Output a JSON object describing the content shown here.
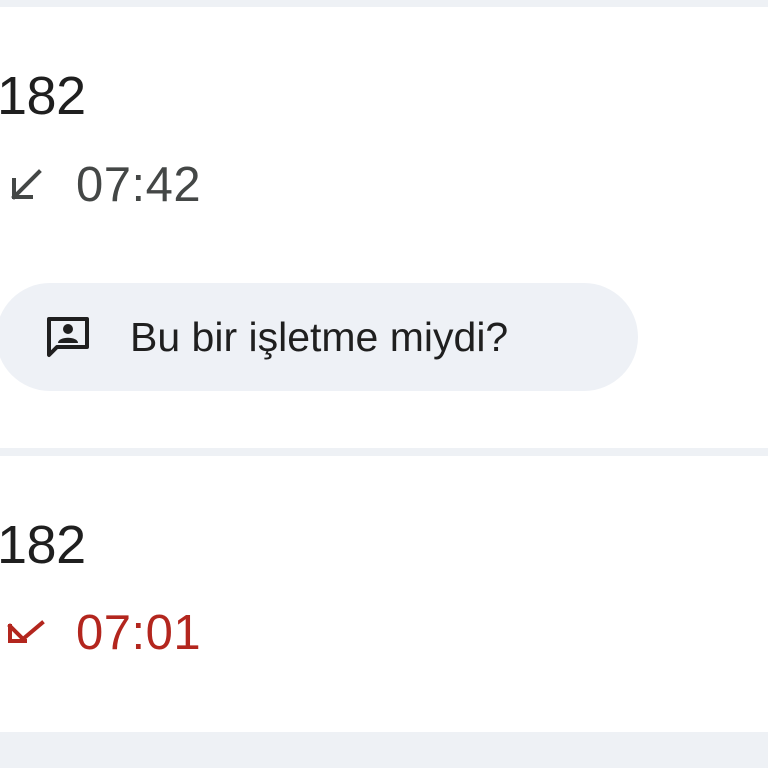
{
  "calls": [
    {
      "number": "182",
      "time": "07:42",
      "direction_icon": "call-received-icon",
      "status": "incoming",
      "status_color": "#444746"
    },
    {
      "number": "182",
      "time": "07:01",
      "direction_icon": "call-missed-icon",
      "status": "missed",
      "status_color": "#b3261e"
    }
  ],
  "business_prompt": {
    "label": "Bu bir işletme miydi?",
    "icon": "feedback-icon"
  },
  "colors": {
    "divider": "#eef1f5",
    "chip_background": "#eef1f6",
    "text_primary": "#1f1f1f"
  }
}
